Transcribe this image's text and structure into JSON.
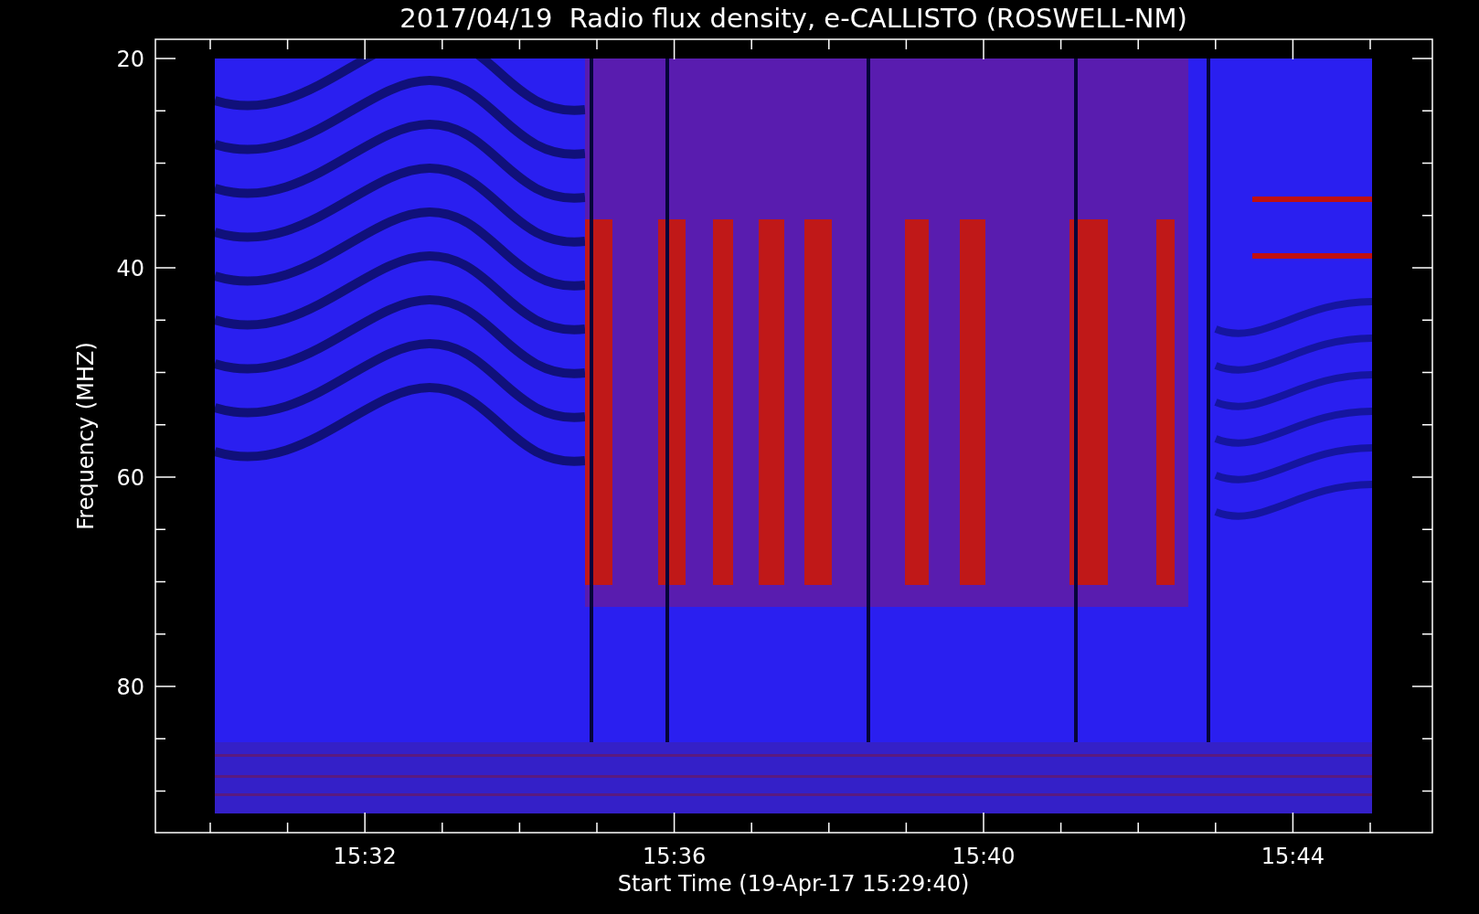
{
  "title": "2017/04/19  Radio flux density, e-CALLISTO (ROSWELL-NM)",
  "y_axis": {
    "label": "Frequency (MHZ)",
    "ticks": [
      "20",
      "40",
      "60",
      "80"
    ]
  },
  "x_axis": {
    "label": "Start Time (19-Apr-17 15:29:40)",
    "ticks": [
      "15:32",
      "15:36",
      "15:40",
      "15:44"
    ]
  }
}
